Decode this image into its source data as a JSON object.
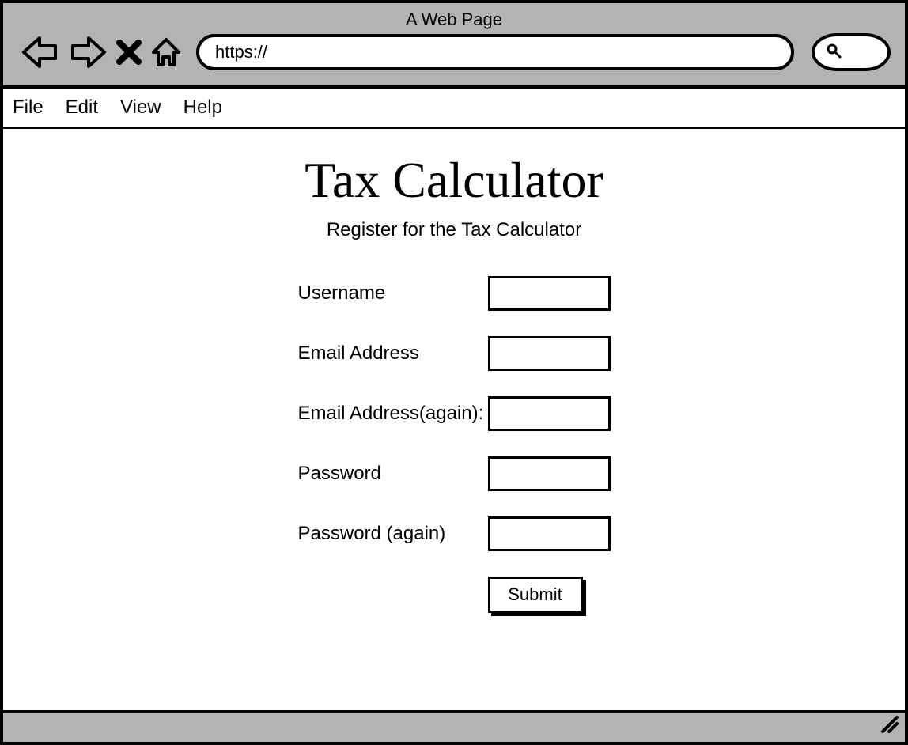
{
  "browser": {
    "title": "A Web Page",
    "url_prefix": "https://"
  },
  "menu": {
    "items": [
      "File",
      "Edit",
      "View",
      "Help"
    ]
  },
  "page": {
    "title": "Tax Calculator",
    "subtitle": "Register for the Tax Calculator"
  },
  "form": {
    "fields": [
      {
        "label": "Username",
        "value": ""
      },
      {
        "label": "Email Address",
        "value": ""
      },
      {
        "label": "Email Address(again):",
        "value": ""
      },
      {
        "label": "Password",
        "value": ""
      },
      {
        "label": "Password (again)",
        "value": ""
      }
    ],
    "submit_label": "Submit"
  }
}
